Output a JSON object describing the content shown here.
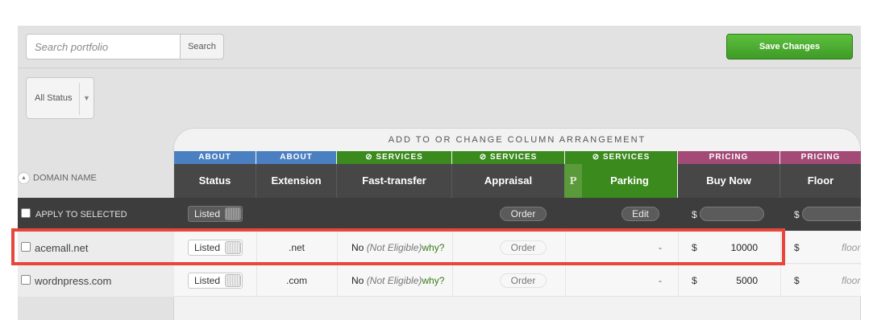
{
  "search": {
    "placeholder": "Search portfolio",
    "button_label": "Search"
  },
  "toolbar": {
    "save_label": "Save Changes"
  },
  "status_filter": {
    "selected": "All Status"
  },
  "arrangement": {
    "label": "ADD TO OR CHANGE COLUMN ARRANGEMENT"
  },
  "table": {
    "domain_header": "DOMAIN NAME",
    "categories": {
      "about": "ABOUT",
      "services": "SERVICES",
      "pricing": "PRICING"
    },
    "columns": {
      "status": "Status",
      "extension": "Extension",
      "fast_transfer": "Fast-transfer",
      "appraisal": "Appraisal",
      "parking_badge": "P",
      "parking": "Parking",
      "buy_now": "Buy Now",
      "floor": "Floor"
    },
    "apply_row": {
      "label": "APPLY TO SELECTED",
      "status": "Listed",
      "appraisal": "Order",
      "parking": "Edit",
      "currency": "$"
    },
    "rows": [
      {
        "domain": "acemall.net",
        "status": "Listed",
        "extension": ".net",
        "fast_no": "No",
        "fast_note": "(Not Eligible)",
        "fast_why": "why?",
        "appraisal": "Order",
        "parking": "-",
        "currency": "$",
        "buy_now": "10000",
        "floor_placeholder": "floor"
      },
      {
        "domain": "wordnpress.com",
        "status": "Listed",
        "extension": ".com",
        "fast_no": "No",
        "fast_note": "(Not Eligible)",
        "fast_why": "why?",
        "appraisal": "Order",
        "parking": "-",
        "currency": "$",
        "buy_now": "5000",
        "floor_placeholder": "floor"
      }
    ]
  },
  "colors": {
    "save_green": "#4cae31",
    "about_blue": "#4a7fc2",
    "services_green": "#3a8a1d",
    "pricing_purple": "#a34a76",
    "highlight_red": "#e8463a"
  }
}
